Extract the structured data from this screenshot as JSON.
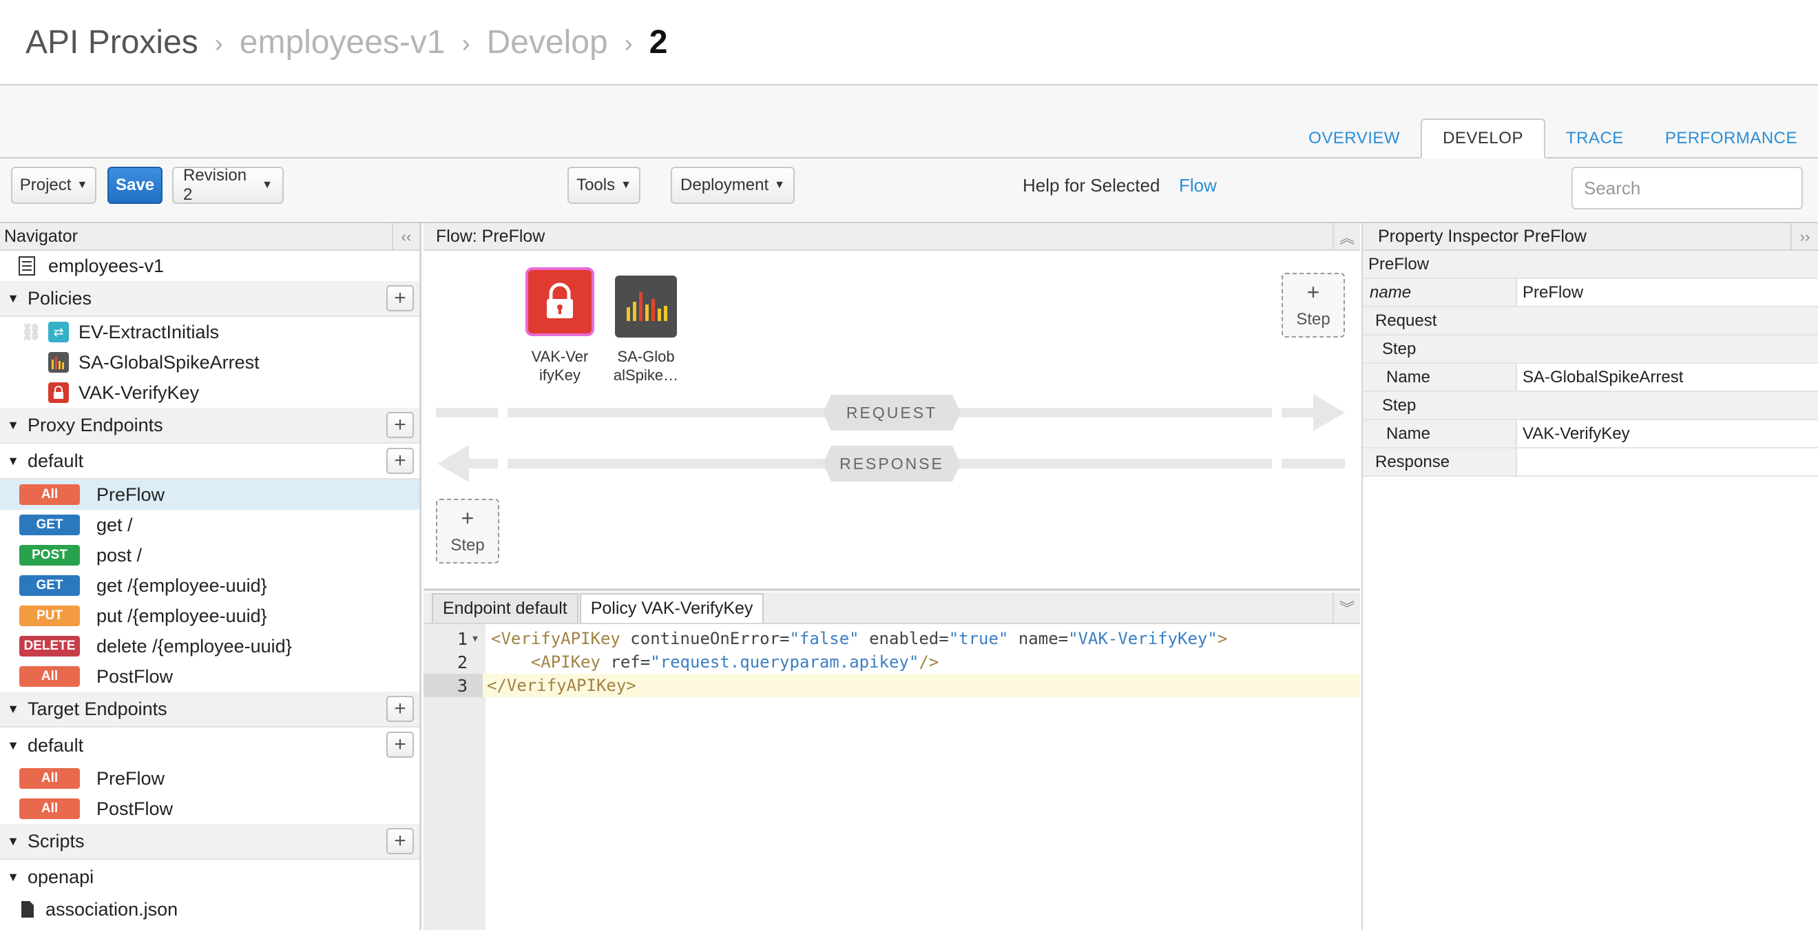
{
  "breadcrumb": {
    "root": "API Proxies",
    "proxy": "employees-v1",
    "section": "Develop",
    "revision": "2",
    "sep": "›"
  },
  "tabs": [
    "OVERVIEW",
    "DEVELOP",
    "TRACE",
    "PERFORMANCE"
  ],
  "active_tab": "DEVELOP",
  "toolbar": {
    "project_label": "Project",
    "save_label": "Save",
    "revision_label": "Revision 2",
    "tools_label": "Tools",
    "deployment_label": "Deployment",
    "help_text": "Help for Selected",
    "help_link": "Flow",
    "search_placeholder": "Search"
  },
  "navigator": {
    "title": "Navigator",
    "collapse_glyph": "‹‹",
    "root_item": "employees-v1",
    "policies_title": "Policies",
    "policies": [
      {
        "label": "EV-ExtractInitials",
        "icon": "extract-variables-icon",
        "color": "#35b0c9"
      },
      {
        "label": "SA-GlobalSpikeArrest",
        "icon": "spike-arrest-icon",
        "color": "#555555"
      },
      {
        "label": "VAK-VerifyKey",
        "icon": "lock-icon",
        "color": "#d63a2f"
      }
    ],
    "proxy_endpoints_title": "Proxy Endpoints",
    "proxy_default": "default",
    "proxy_flows": [
      {
        "method": "All",
        "label": "PreFlow"
      },
      {
        "method": "GET",
        "label": "get /"
      },
      {
        "method": "POST",
        "label": "post /"
      },
      {
        "method": "GET",
        "label": "get /{employee-uuid}"
      },
      {
        "method": "PUT",
        "label": "put /{employee-uuid}"
      },
      {
        "method": "DELETE",
        "label": "delete /{employee-uuid}"
      },
      {
        "method": "All",
        "label": "PostFlow"
      }
    ],
    "target_endpoints_title": "Target Endpoints",
    "target_default": "default",
    "target_flows": [
      {
        "method": "All",
        "label": "PreFlow"
      },
      {
        "method": "All",
        "label": "PostFlow"
      }
    ],
    "scripts_title": "Scripts",
    "scripts_folder": "openapi",
    "scripts_file": "association.json"
  },
  "flow": {
    "title": "Flow: PreFlow",
    "request_label": "REQUEST",
    "response_label": "RESPONSE",
    "step_plus": "+",
    "step_label": "Step",
    "tiles": [
      {
        "label": "VAK-Ver ifyKey",
        "line1": "VAK-Ver",
        "line2": "ifyKey"
      },
      {
        "label": "SA-Glob alSpike…",
        "line1": "SA-Glob",
        "line2": "alSpike…"
      }
    ]
  },
  "code": {
    "tabs": [
      "Endpoint default",
      "Policy VAK-VerifyKey"
    ],
    "lines": [
      {
        "n": "1",
        "tag_open": "<VerifyAPIKey",
        "a1": " continueOnError=",
        "v1": "\"false\"",
        "a2": " enabled=",
        "v2": "\"true\"",
        "a3": " name=",
        "v3": "\"VAK-VerifyKey\"",
        "tag_close": ">"
      },
      {
        "n": "2",
        "indent": "    ",
        "tag_open": "<APIKey",
        "a1": " ref=",
        "v1": "\"request.queryparam.apikey\"",
        "tag_close": "/>"
      },
      {
        "n": "3",
        "tag_open": "</VerifyAPIKey>"
      }
    ]
  },
  "inspector": {
    "title": "Property Inspector  PreFlow",
    "collapse_glyph": "››",
    "rows": {
      "preflow": "PreFlow",
      "name_key": "name",
      "name_val": "PreFlow",
      "request": "Request",
      "step1": "Step",
      "step1_name_key": "Name",
      "step1_name_val": "SA-GlobalSpikeArrest",
      "step2": "Step",
      "step2_name_key": "Name",
      "step2_name_val": "VAK-VerifyKey",
      "response": "Response"
    }
  }
}
